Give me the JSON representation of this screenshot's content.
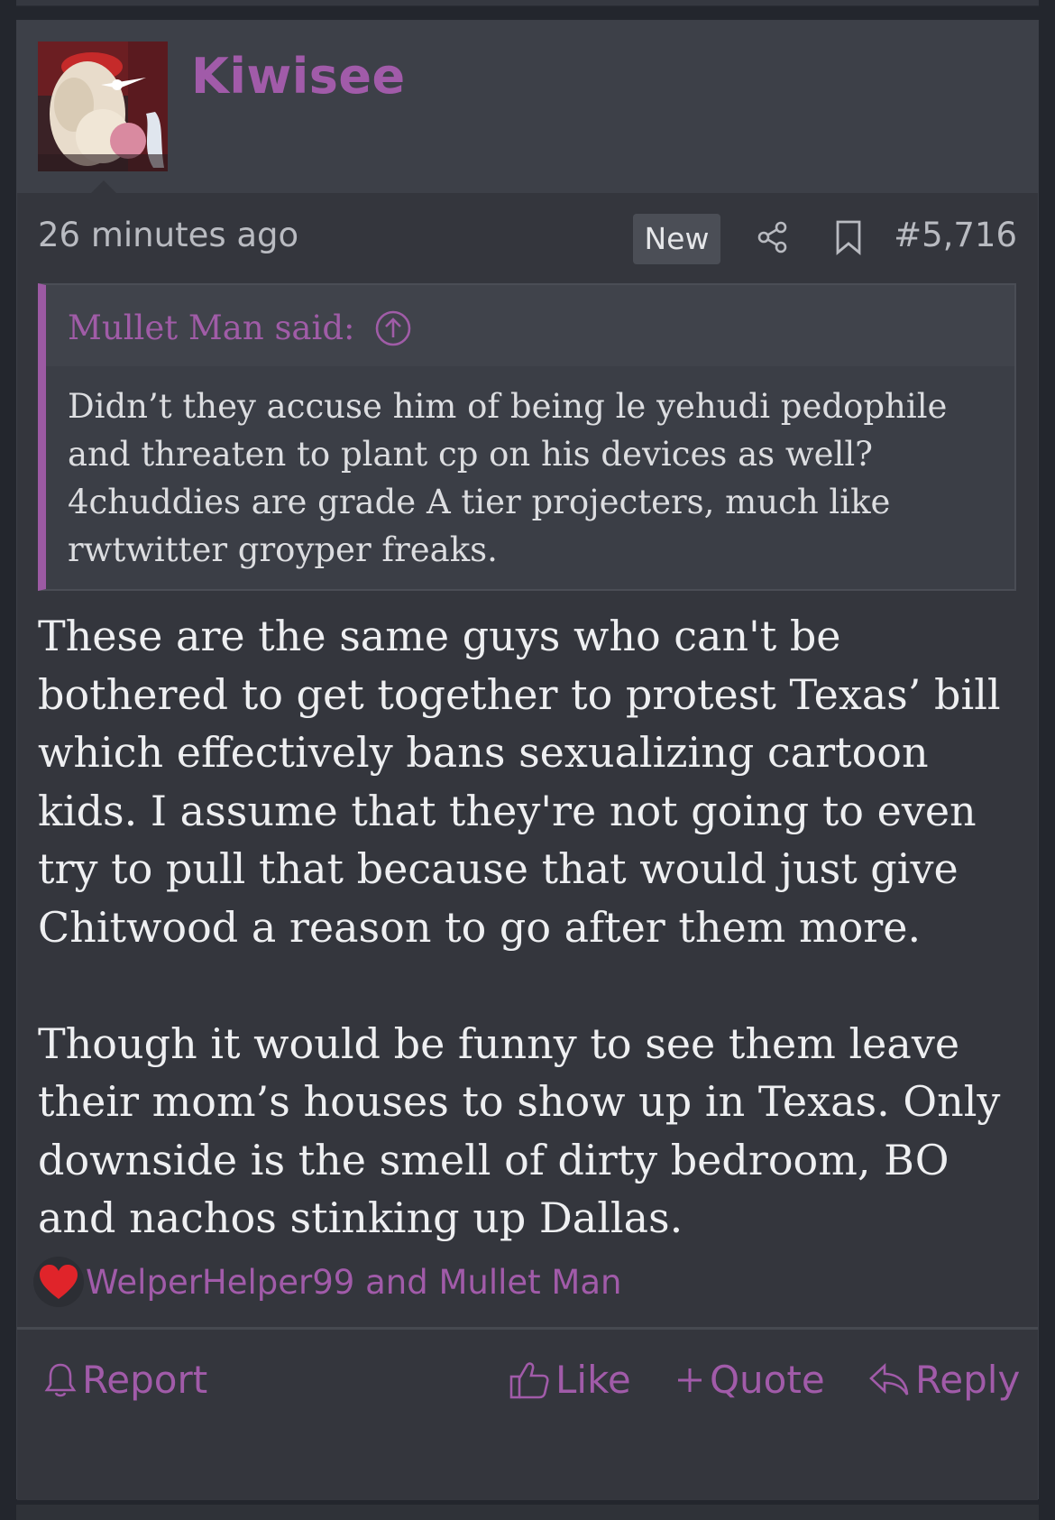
{
  "post": {
    "username": "Kiwisee",
    "time": "26 minutes ago",
    "new_badge": "New",
    "post_number": "#5,716",
    "quote": {
      "attribution": "Mullet Man said:",
      "text": "Didn’t they accuse him of being le yehudi pedophile and threaten to plant cp on his devices as well? 4chuddies are grade A tier projecters, much like rwtwitter groyper freaks."
    },
    "body": [
      "These are the same guys who can't be bothered to get together to protest Texas’ bill which effectively bans sexualizing cartoon kids. I assume that they're not going to even try to pull that because that would just give Chitwood a reason to go after them more.",
      "Though it would be funny to see them leave their mom’s houses to show up in Texas. Only downside is the smell of dirty bedroom, BO and nachos stinking up Dallas."
    ],
    "reactions": {
      "icon": "heart-icon",
      "names": "WelperHelper99 and Mullet Man"
    },
    "actions": {
      "report": "Report",
      "like": "Like",
      "quote": "Quote",
      "reply": "Reply"
    }
  },
  "colors": {
    "accent": "#a15ba9",
    "background": "#34363d",
    "header": "#3d4048",
    "text": "#eeeff1"
  }
}
